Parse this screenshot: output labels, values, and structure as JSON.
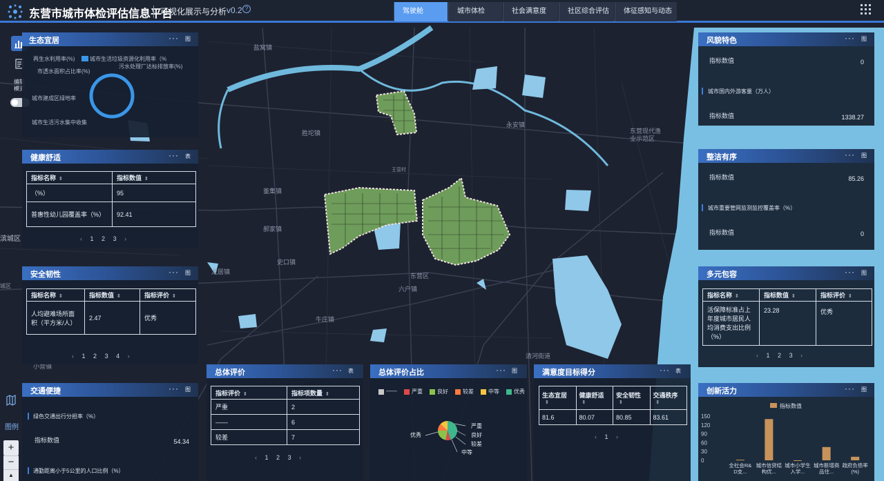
{
  "header": {
    "title": "东营市城市体检评估信息平台",
    "subtitle": "可视化展示与分析",
    "version": "v0.2",
    "help": "?",
    "tabs": [
      {
        "label": "驾驶舱",
        "active": true
      },
      {
        "label": "城市体检",
        "active": false
      },
      {
        "label": "社会满意度",
        "active": false
      },
      {
        "label": "社区综合评估",
        "active": false
      },
      {
        "label": "体征感知与动态监",
        "active": false
      }
    ]
  },
  "left_tools": {
    "edit_mode_label": "编辑模式",
    "legend_label": "图例"
  },
  "map_labels": [
    "盐窝镇",
    "胜坨镇",
    "永安镇",
    "东营现代渔业示范区",
    "王营村",
    "董集镇",
    "郝家镇",
    "史口镇",
    "龙居镇",
    "东营区",
    "六户镇",
    "牛庄镇",
    "滨城区",
    "清河街道",
    "小营镇",
    "城区"
  ],
  "panels": {
    "eco": {
      "title": "生态宜居",
      "table_label": "图",
      "legend_items": [
        "再生水利用率(%)",
        "城市生活垃圾资源化利用率（%",
        "市透水面积占比率(%)",
        "污水处理厂达标排放率(%)",
        "城市建成区绿地率",
        "城市生活污水集中收集"
      ]
    },
    "health": {
      "title": "健康舒适",
      "table_label": "表",
      "headers": [
        "指标名称",
        "指标数值"
      ],
      "rows": [
        {
          "name": "（%）",
          "value": "95"
        },
        {
          "name": "普惠性幼儿园覆盖率（%）",
          "value": "92.41"
        }
      ],
      "pages": [
        "1",
        "2",
        "3"
      ]
    },
    "safety": {
      "title": "安全韧性",
      "table_label": "图",
      "headers": [
        "指标名称",
        "指标数值",
        "指标评价"
      ],
      "rows": [
        {
          "name": "人均避难场所面积（平方米/人）",
          "value": "2.47",
          "rating": "优秀"
        }
      ],
      "pages": [
        "1",
        "2",
        "3",
        "4"
      ]
    },
    "traffic": {
      "title": "交通便捷",
      "table_label": "图",
      "item1_label": "绿色交通出行分担率（%）",
      "item1_key": "指标数值",
      "item1_value": "54.34",
      "item2_label": "通勤距离小于5公里的人口比例（%）"
    },
    "overall": {
      "title": "总体评价",
      "table_label": "表",
      "headers": [
        "指标评价",
        "指标项数量"
      ],
      "rows": [
        {
          "name": "严重",
          "value": "2"
        },
        {
          "name": "——",
          "value": "6"
        },
        {
          "name": "较差",
          "value": "7"
        }
      ],
      "pages": [
        "1",
        "2",
        "3"
      ]
    },
    "ratio": {
      "title": "总体评价占比",
      "table_label": "图",
      "legend": [
        {
          "label": "——",
          "color": "#c8c8c8"
        },
        {
          "label": "严重",
          "color": "#e04848"
        },
        {
          "label": "良好",
          "color": "#8bc34a"
        },
        {
          "label": "较差",
          "color": "#ff7a3d"
        },
        {
          "label": "中等",
          "color": "#f5c542"
        },
        {
          "label": "优秀",
          "color": "#3fb68b"
        }
      ],
      "slice_labels": [
        "优秀",
        "严重",
        "良好",
        "较差",
        "中等"
      ]
    },
    "satisfaction": {
      "title": "满意度目标得分",
      "table_label": "表",
      "headers": [
        "生态宜居",
        "健康舒适",
        "安全韧性",
        "交通秩序"
      ],
      "values": [
        "81.6",
        "80.07",
        "80.85",
        "83.61"
      ],
      "pages": [
        "1"
      ]
    },
    "style": {
      "title": "风貌特色",
      "table_label": "图",
      "item1_key": "指标数值",
      "item1_value": "0",
      "item2_label": "城市国内外游客量（万人）",
      "item2_key": "指标数值",
      "item2_value": "1338.27"
    },
    "order": {
      "title": "整洁有序",
      "table_label": "图",
      "item1_key": "指标数值",
      "item1_value": "85.26",
      "item2_label": "城市重要管网监测监控覆盖率（%）",
      "item2_key": "指标数值",
      "item2_value": "0"
    },
    "inclusive": {
      "title": "多元包容",
      "table_label": "图",
      "headers": [
        "指标名称",
        "指标数值",
        "指标评价"
      ],
      "rows": [
        {
          "name": "活保障标准占上年度城市居民人均消费支出比例（%）",
          "value": "23.28",
          "rating": "优秀"
        }
      ],
      "pages": [
        "1",
        "2",
        "3"
      ]
    },
    "vitality": {
      "title": "创新活力",
      "table_label": "图"
    }
  },
  "chart_data": {
    "type": "bar",
    "legend": "指标数值",
    "categories": [
      "全社会R&D支...",
      "城市信贷结构优...",
      "城市小学生入学...",
      "城市新增商品住...",
      "政府负债率(%)"
    ],
    "values": [
      2,
      140,
      0,
      45,
      12
    ],
    "ylim": [
      0,
      150
    ],
    "yticks": [
      "150",
      "120",
      "90",
      "60",
      "30",
      "0"
    ],
    "bar_color": "#c8935a"
  }
}
